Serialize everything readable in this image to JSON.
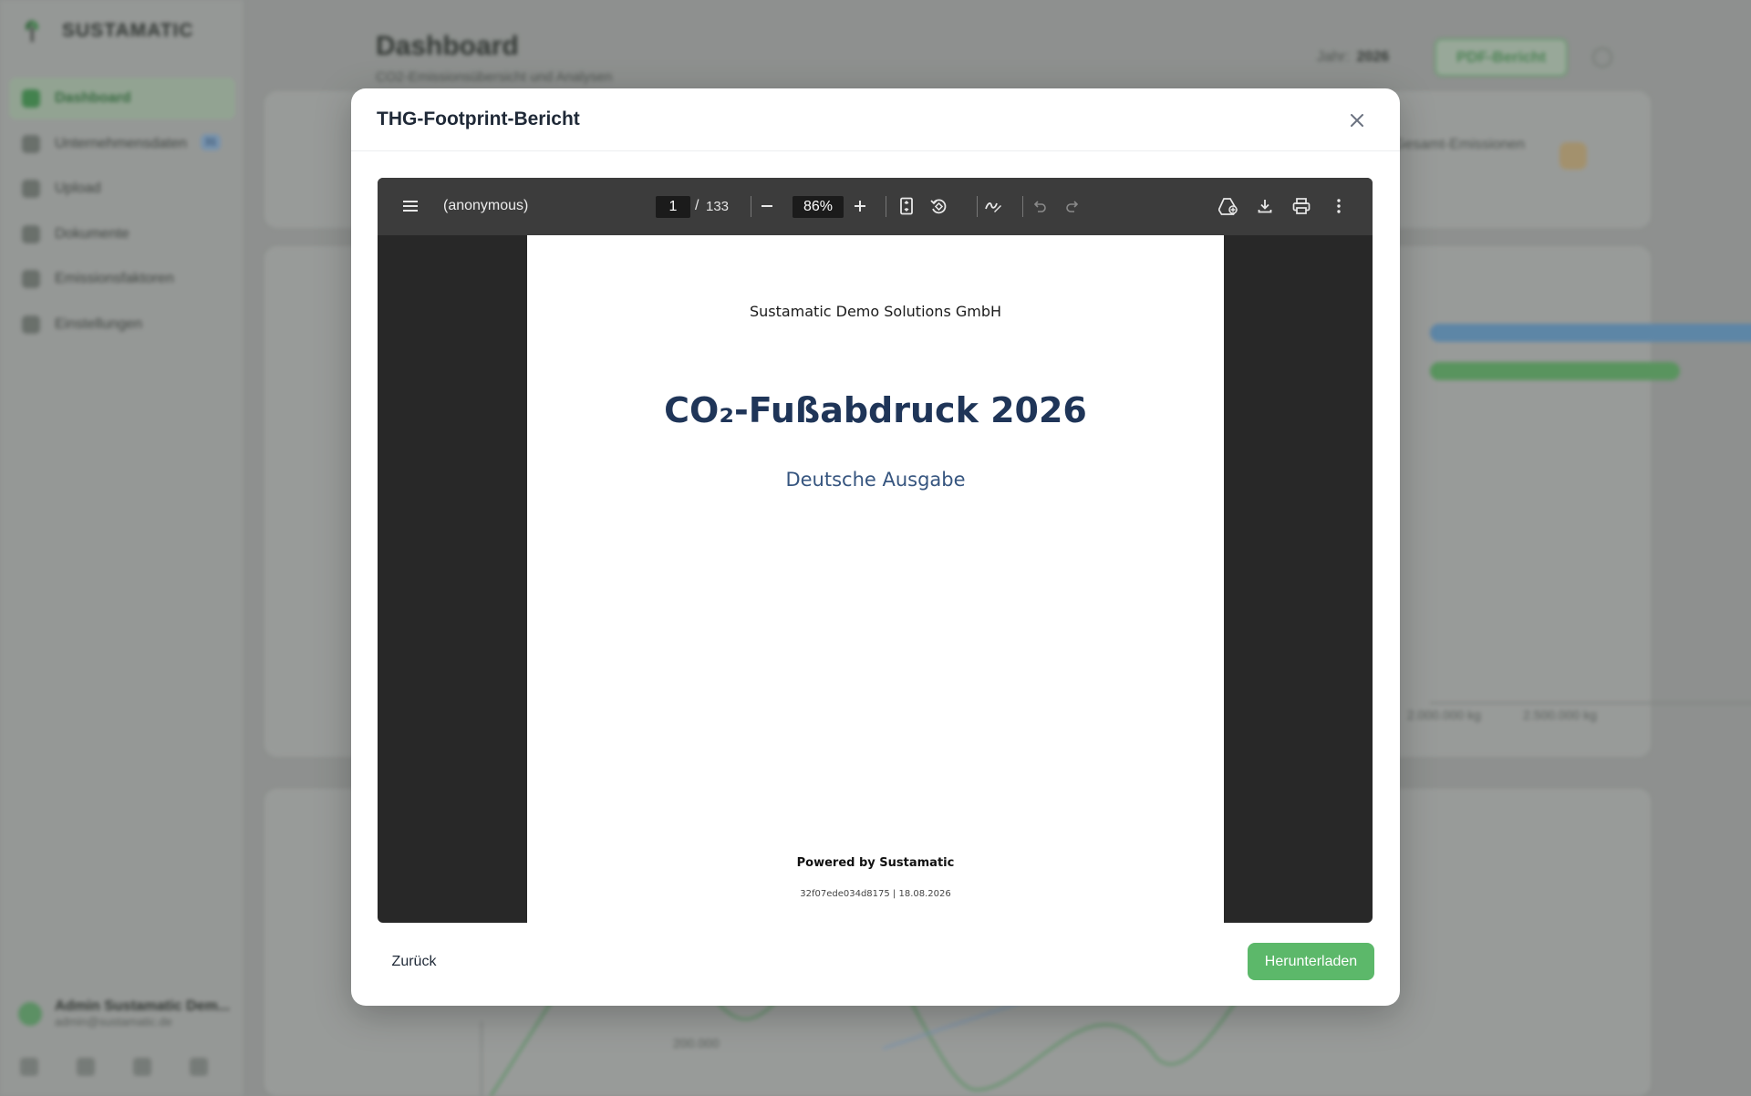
{
  "app": {
    "brand": "SUSTAMATIC",
    "nav": [
      {
        "label": "Dashboard",
        "icon": "dashboard-icon",
        "active": true
      },
      {
        "label": "Unternehmensdaten",
        "icon": "building-icon",
        "badge": "31"
      },
      {
        "label": "Upload",
        "icon": "upload-icon"
      },
      {
        "label": "Dokumente",
        "icon": "document-icon"
      },
      {
        "label": "Emissionsfaktoren",
        "icon": "leaf-icon"
      },
      {
        "label": "Einstellungen",
        "icon": "gear-icon"
      }
    ],
    "user": {
      "name": "Admin Sustamatic Dem...",
      "email": "admin@sustamatic.de"
    },
    "page_title": "Dashboard",
    "page_subtitle": "CO2-Emissionsübersicht und Analysen",
    "year_label": "Jahr:",
    "year_value": "2026",
    "pdf_button": "PDF-Bericht",
    "kpi_label": "Gesamt-Emissionen",
    "axis_ticks": [
      "2.000.000 kg",
      "2.500.000 kg"
    ],
    "y_tick": "200.000"
  },
  "modal": {
    "title": "THG-Footprint-Bericht",
    "viewer": {
      "document_name": "(anonymous)",
      "page_current": "1",
      "page_separator": "/",
      "page_total": "133",
      "zoom": "86%"
    },
    "pdf": {
      "company": "Sustamatic Demo Solutions GmbH",
      "title": "CO₂-Fußabdruck 2026",
      "subtitle": "Deutsche Ausgabe",
      "powered": "Powered by Sustamatic",
      "footer_id": "32f07ede034d8175 | 18.08.2026"
    },
    "back_label": "Zurück",
    "download_label": "Herunterladen"
  },
  "colors": {
    "accent_green": "#5cb86a",
    "pdf_title": "#1f3558",
    "pdf_subtitle": "#36557f",
    "viewer_toolbar": "#3c3c3c",
    "viewer_bg": "#282828"
  }
}
